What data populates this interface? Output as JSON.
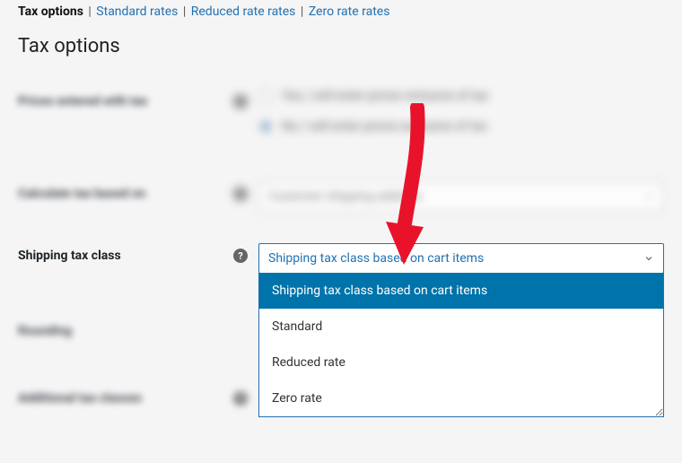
{
  "subtabs": {
    "active": "Tax options",
    "items": [
      "Standard rates",
      "Reduced rate rates",
      "Zero rate rates"
    ]
  },
  "page_title": "Tax options",
  "rows": {
    "prices_entered": {
      "label": "Prices entered with tax",
      "opt1": "Yes, I will enter prices inclusive of tax",
      "opt2": "No, I will enter prices exclusive of tax"
    },
    "calc_based": {
      "label": "Calculate tax based on",
      "value": "Customer shipping address"
    },
    "shipping_class": {
      "label": "Shipping tax class",
      "selected": "Shipping tax class based on cart items",
      "options": [
        "Shipping tax class based on cart items",
        "Standard",
        "Reduced rate",
        "Zero rate"
      ]
    },
    "rounding": {
      "label": "Rounding"
    },
    "additional": {
      "label": "Additional tax classes"
    }
  }
}
